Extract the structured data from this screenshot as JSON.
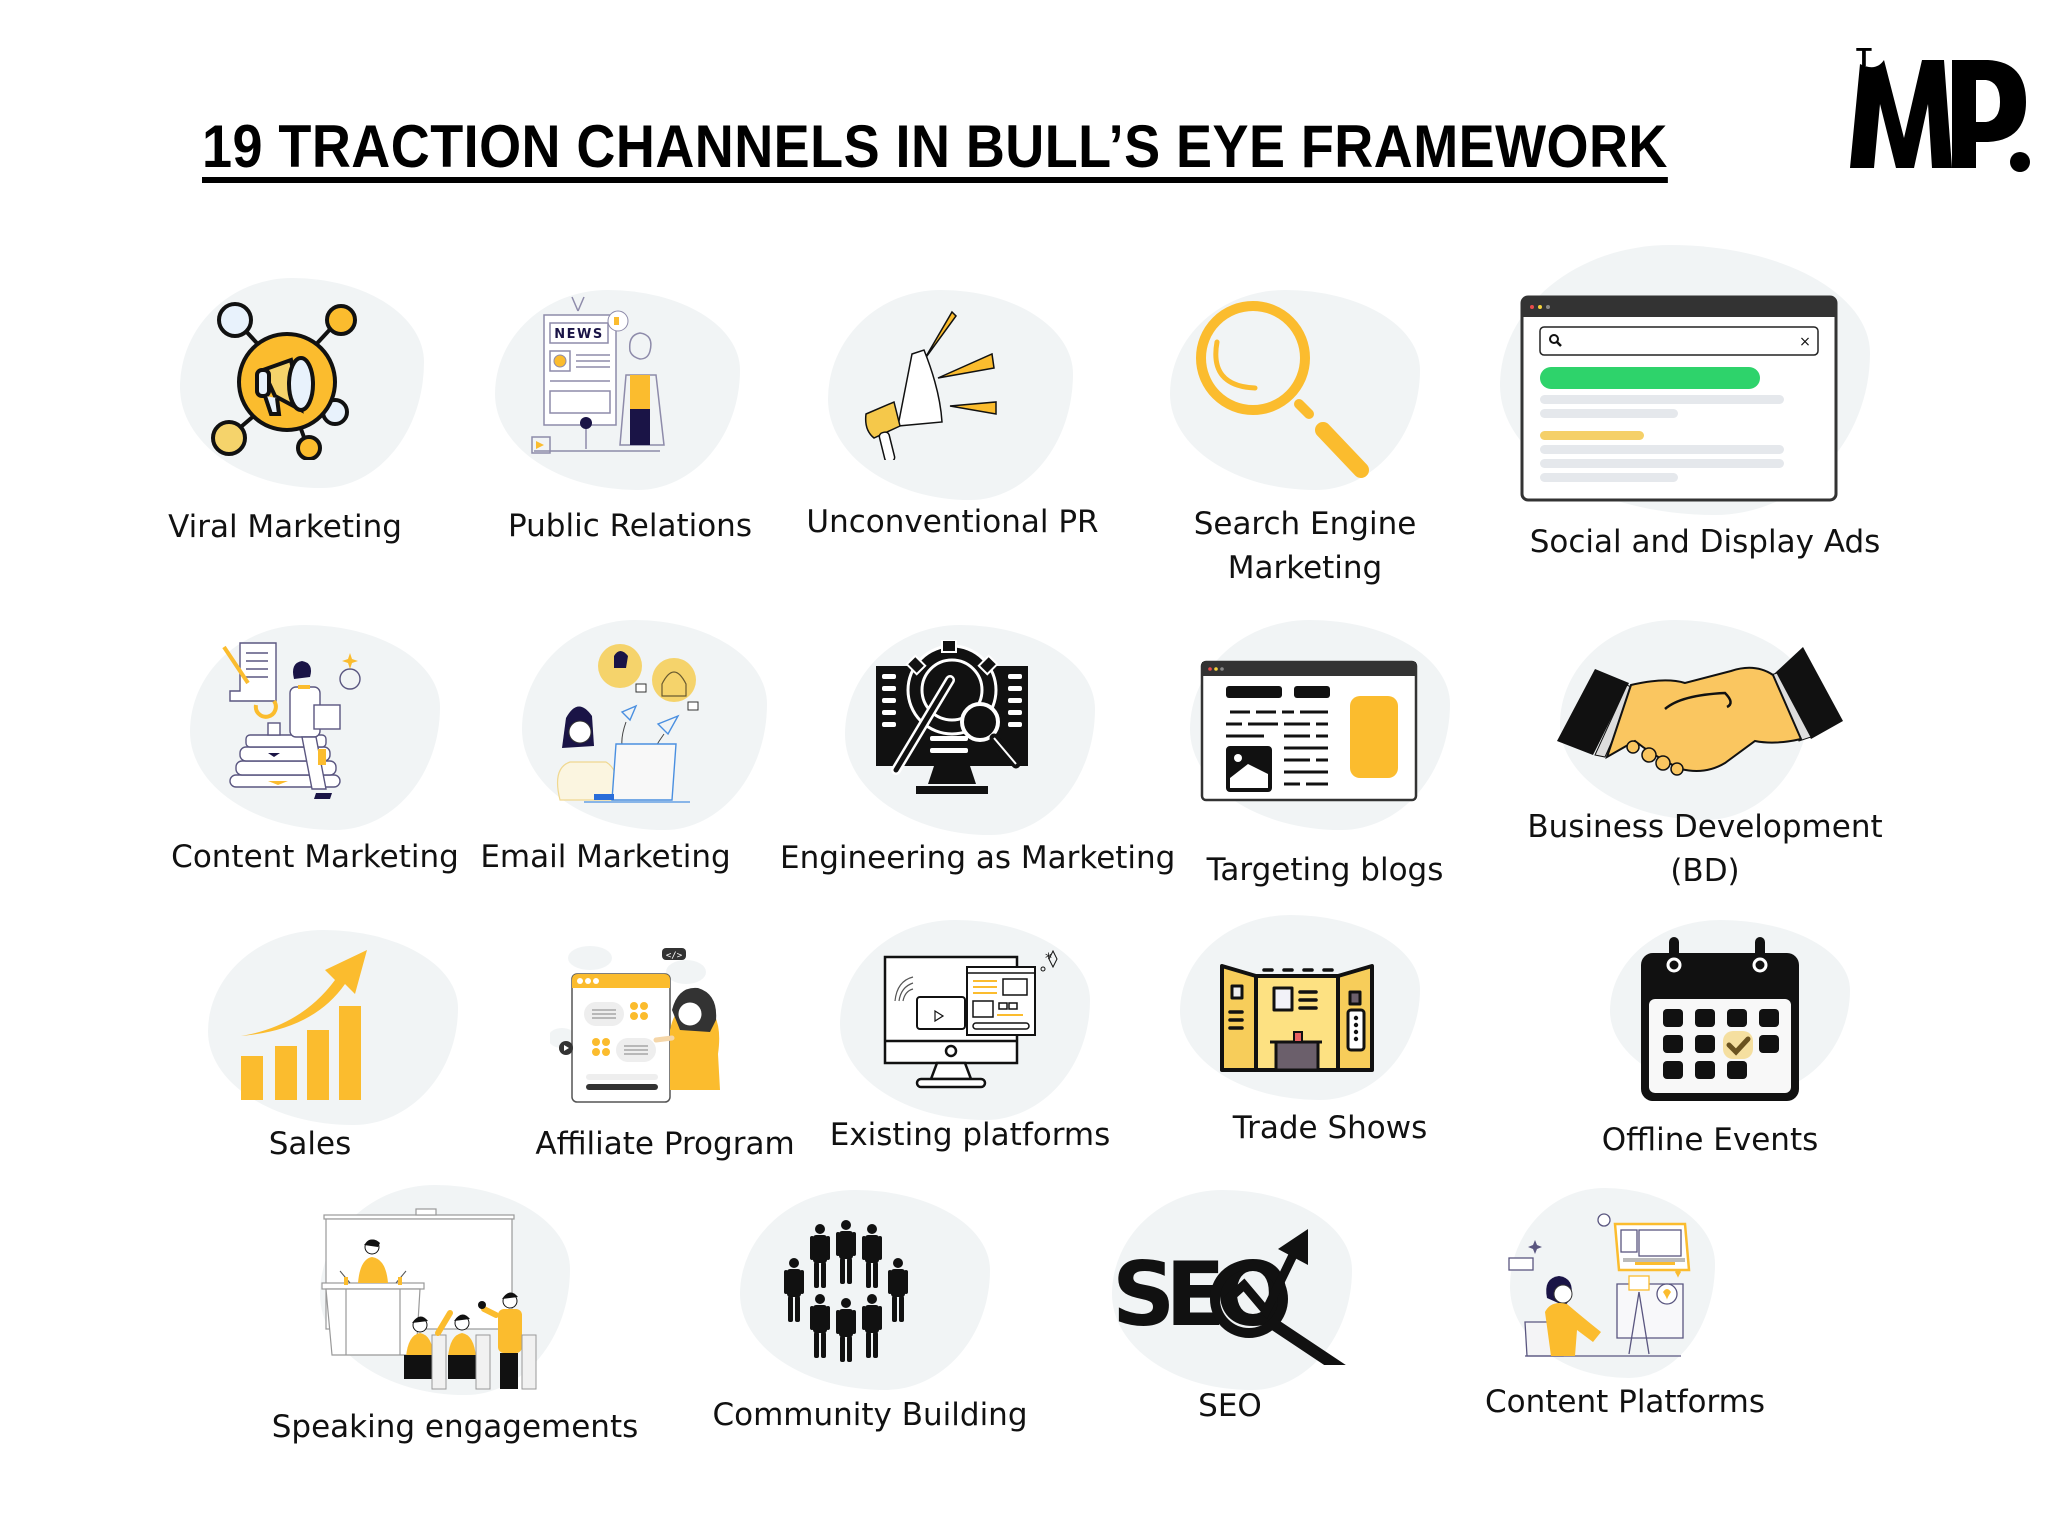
{
  "header": {
    "title": "19 TRACTION CHANNELS IN BULL’S EYE FRAMEWORK",
    "logo_text": "MP.",
    "logo_superscript": "T"
  },
  "colors": {
    "accent_yellow": "#FBBC2E",
    "light_yellow": "#F5D36B",
    "blob_background": "#F1F4F5",
    "ink": "#111111",
    "green_bar": "#2ED36B",
    "navy": "#1A1446"
  },
  "channels": [
    {
      "label": "Viral Marketing",
      "icon": "megaphone-network-icon"
    },
    {
      "label": "Public Relations",
      "icon": "news-presenter-icon"
    },
    {
      "label": "Unconventional PR",
      "icon": "megaphone-icon"
    },
    {
      "label": "Search Engine Marketing",
      "icon": "magnifier-icon"
    },
    {
      "label": "Social and Display Ads",
      "icon": "browser-search-results-icon"
    },
    {
      "label": "Content Marketing",
      "icon": "writer-on-books-icon"
    },
    {
      "label": "Email Marketing",
      "icon": "email-sender-icon"
    },
    {
      "label": "Engineering as Marketing",
      "icon": "monitor-gear-wrench-icon"
    },
    {
      "label": "Targeting blogs",
      "icon": "blog-page-icon"
    },
    {
      "label": "Business Development (BD)",
      "icon": "handshake-icon"
    },
    {
      "label": "Sales",
      "icon": "growth-chart-icon"
    },
    {
      "label": "Affiliate Program",
      "icon": "affiliate-webpage-icon"
    },
    {
      "label": "Existing platforms",
      "icon": "desktop-platforms-icon"
    },
    {
      "label": "Trade Shows",
      "icon": "trade-booth-icon"
    },
    {
      "label": "Offline Events",
      "icon": "calendar-check-icon"
    },
    {
      "label": "Speaking engagements",
      "icon": "speaker-audience-icon"
    },
    {
      "label": "Community Building",
      "icon": "people-group-icon"
    },
    {
      "label": "SEO",
      "icon": "seo-magnifier-icon"
    },
    {
      "label": "Content Platforms",
      "icon": "content-creator-icon"
    }
  ],
  "labels_multiline": {
    "sem_line1": "Search Engine",
    "sem_line2": "Marketing",
    "bd_line1": "Business Development",
    "bd_line2": "(BD)"
  },
  "icon_text": {
    "news": "NEWS",
    "seo": "SEO",
    "code_tag": "</>",
    "search_clear": "×"
  }
}
